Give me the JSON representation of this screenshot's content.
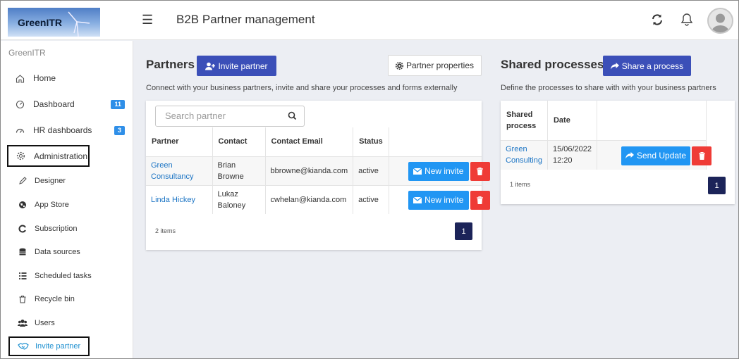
{
  "header": {
    "logo_text": "GreenITR",
    "app_title": "B2B Partner management",
    "icons": [
      "menu-icon",
      "refresh-icon",
      "bell-icon",
      "avatar"
    ]
  },
  "sidebar": {
    "brand": "GreenITR",
    "items": [
      {
        "label": "Home",
        "icon": "home-icon"
      },
      {
        "label": "Dashboard",
        "icon": "dashboard-icon",
        "badge": "11"
      },
      {
        "label": "HR dashboards",
        "icon": "gauge-icon",
        "badge": "3"
      },
      {
        "label": "Administration",
        "icon": "gear-icon"
      }
    ],
    "sub_items": [
      {
        "label": "Designer",
        "icon": "pencil-icon"
      },
      {
        "label": "App Store",
        "icon": "globe-icon"
      },
      {
        "label": "Subscription",
        "icon": "subscription-icon"
      },
      {
        "label": "Data sources",
        "icon": "database-icon"
      },
      {
        "label": "Scheduled tasks",
        "icon": "tasks-icon"
      },
      {
        "label": "Recycle bin",
        "icon": "trash-icon"
      },
      {
        "label": "Users",
        "icon": "users-icon"
      },
      {
        "label": "Invite partner",
        "icon": "handshake-icon"
      }
    ]
  },
  "partners": {
    "title": "Partners",
    "invite_button": "Invite partner",
    "properties_button": "Partner properties",
    "description": "Connect with your business partners, invite and share your processes and forms externally",
    "search_placeholder": "Search partner",
    "columns": [
      "Partner",
      "Contact",
      "Contact Email",
      "Status"
    ],
    "rows": [
      {
        "partner": "Green Consultancy",
        "contact": "Brian Browne",
        "email": "bbrowne@kianda.com",
        "status": "active",
        "action": "New invite"
      },
      {
        "partner": "Linda Hickey",
        "contact": "Lukaz Baloney",
        "email": "cwhelan@kianda.com",
        "status": "active",
        "action": "New invite"
      }
    ],
    "items_count": "2 items",
    "page": "1"
  },
  "shared": {
    "title": "Shared processes",
    "share_button": "Share a process",
    "description": "Define the processes to share with with your business partners",
    "columns": [
      "Shared process",
      "Date"
    ],
    "rows": [
      {
        "process": "Green Consulting",
        "date": "15/06/2022 12:20",
        "action": "Send Update"
      }
    ],
    "items_count": "1 items",
    "page": "1"
  },
  "colors": {
    "primary": "#3b4fb8",
    "info": "#2196f3",
    "danger": "#ef3b36",
    "pager": "#1c2459",
    "badge": "#2f8fe8",
    "link": "#1b74c4"
  }
}
